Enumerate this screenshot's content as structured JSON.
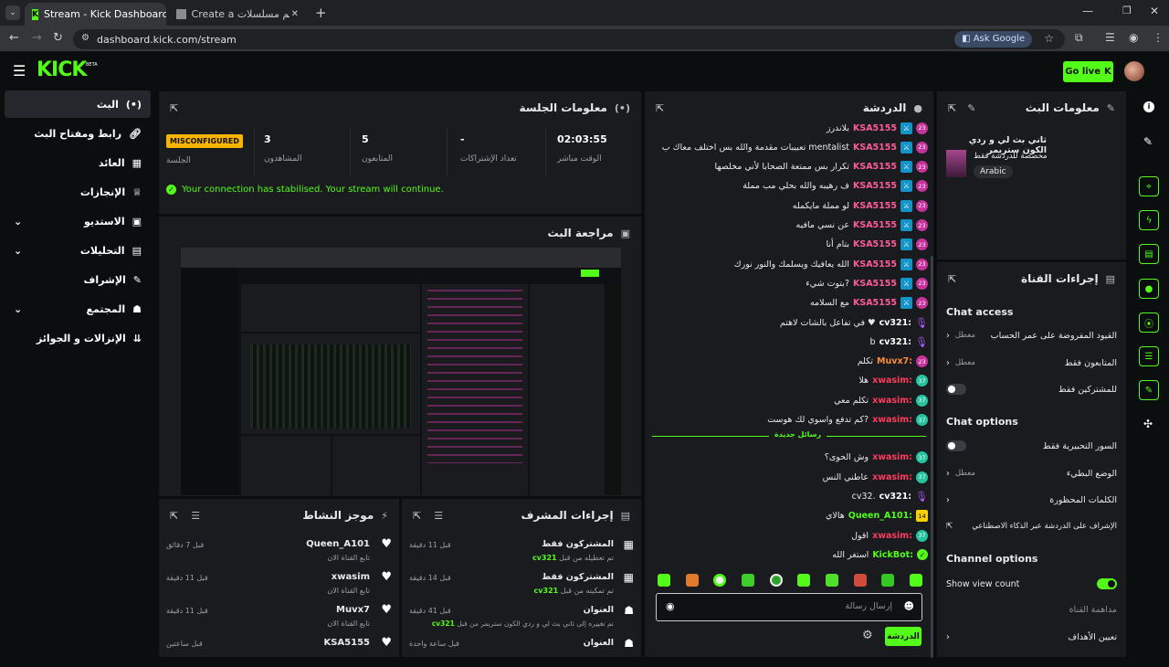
{
  "browser": {
    "tabs": [
      {
        "title": "Stream - Kick Dashboard"
      },
      {
        "title": "Create a تقييم مسلسلات Tier Li"
      }
    ],
    "url": "dashboard.kick.com/stream",
    "ask_google": "Ask Google"
  },
  "header": {
    "logo": "KICK",
    "beta": "BETA",
    "go_live": "Go live"
  },
  "nav": [
    {
      "label": "البث",
      "icon": "broadcast-icon"
    },
    {
      "label": "رابط ومفتاح البث",
      "icon": "link-icon"
    },
    {
      "label": "العائد",
      "icon": "analytics-icon"
    },
    {
      "label": "الإنجازات",
      "icon": "trophy-icon"
    },
    {
      "label": "الاستديو",
      "icon": "studio-icon"
    },
    {
      "label": "التحليلات",
      "icon": "chart-icon"
    },
    {
      "label": "الإشراف",
      "icon": "wrench-icon"
    },
    {
      "label": "المجتمع",
      "icon": "community-icon"
    },
    {
      "label": "الإنزالات و الجوائز",
      "icon": "drops-icon"
    }
  ],
  "session": {
    "title": "معلومات الجلسة",
    "stats": [
      {
        "value": "MISCONFIGURED",
        "label": "الجلسة"
      },
      {
        "value": "3",
        "label": "المشاهدون"
      },
      {
        "value": "5",
        "label": "المتابعون"
      },
      {
        "value": "-",
        "label": "تعداد الإشتراكات"
      },
      {
        "value": "02:03:55",
        "label": "الوقت مباشر"
      }
    ],
    "status": "Your connection has stabilised. Your stream will continue."
  },
  "preview": {
    "title": "مراجعة البث"
  },
  "chat": {
    "title": "الدردشة",
    "messages": [
      {
        "lvl": "23",
        "user": "KSA5155",
        "text": "بلاندرز",
        "type": "pink",
        "mod": true
      },
      {
        "lvl": "23",
        "user": "KSA5155",
        "text": "mentalist تعبيبات مقدمة والله بس اختلف معاك ب",
        "type": "pink",
        "mod": true
      },
      {
        "lvl": "23",
        "user": "KSA5155",
        "text": "تكرار بس ممتعة الصحابا لأني مخلصها",
        "type": "pink",
        "mod": true
      },
      {
        "lvl": "23",
        "user": "KSA5155",
        "text": "ف رهيبه والله بحلي مب مملة",
        "type": "pink",
        "mod": true
      },
      {
        "lvl": "23",
        "user": "KSA5155",
        "text": "لو مملة مايكمله",
        "type": "pink",
        "mod": true
      },
      {
        "lvl": "23",
        "user": "KSA5155",
        "text": "عن نسي مافيه",
        "type": "pink",
        "mod": true
      },
      {
        "lvl": "23",
        "user": "KSA5155",
        "text": "بتام أنا",
        "type": "pink",
        "mod": true
      },
      {
        "lvl": "23",
        "user": "KSA5155",
        "text": "الله يعافيك ويسلمك والنور نورك",
        "type": "pink",
        "mod": true
      },
      {
        "lvl": "23",
        "user": "KSA5155",
        "text": "?بتوت شيء",
        "type": "pink",
        "mod": true
      },
      {
        "lvl": "23",
        "user": "KSA5155",
        "text": "مع السلامه",
        "type": "pink",
        "mod": true
      },
      {
        "lvl": "",
        "user": "cv321:",
        "text": "♥ في تفاعل بالشات لاهتم",
        "type": "white",
        "mic": true
      },
      {
        "lvl": "",
        "user": "cv321:",
        "text": "b",
        "type": "white",
        "mic": true
      },
      {
        "lvl": "23",
        "user": "Muvx7:",
        "text": "تكلم",
        "type": "orange"
      },
      {
        "lvl": "37",
        "user": "xwasim:",
        "text": "هلا",
        "type": "red",
        "teal": true
      },
      {
        "lvl": "37",
        "user": "xwasim:",
        "text": "تكلم معي",
        "type": "red",
        "teal": true
      },
      {
        "lvl": "37",
        "user": "xwasim:",
        "text": "?كم تدفع واسوي لك هوست",
        "type": "red",
        "teal": true
      }
    ],
    "new_messages": "رسائل جديدة",
    "messages2": [
      {
        "lvl": "37",
        "user": "xwasim:",
        "text": "وش الحوى؟",
        "type": "red",
        "teal": true
      },
      {
        "lvl": "37",
        "user": "xwasim:",
        "text": "عاطني النس",
        "type": "red",
        "teal": true
      },
      {
        "lvl": "",
        "user": "cv321:",
        "text": ".cv32",
        "type": "white",
        "mic": true
      },
      {
        "lvl": "14",
        "user": "Queen_A101:",
        "text": "هالاي",
        "type": "green",
        "yellow": true
      },
      {
        "lvl": "37",
        "user": "xwasim:",
        "text": "اقول",
        "type": "red",
        "teal": true
      },
      {
        "lvl": "",
        "user": "KickBot:",
        "text": "استغر الله",
        "type": "green",
        "bot": true
      }
    ],
    "placeholder": "إرسال رسالة",
    "send": "الدردشة"
  },
  "stream_info": {
    "title": "معلومات البث",
    "stream_title": "ثاني بث لي و ردي الكون ستريمر",
    "category_note": "مخصصة للدردشة فقط",
    "tag": "Arabic"
  },
  "channel_actions": {
    "title": "إجراءات القناة",
    "chat_access": "Chat access",
    "rows_access": [
      {
        "label": "القيود المفروضة على عمر الحساب",
        "value": "معطل",
        "control": "chevron"
      },
      {
        "label": "المتابعون فقط",
        "value": "معطل",
        "control": "chevron"
      },
      {
        "label": "للمشتركين فقط",
        "value": "",
        "control": "toggle",
        "on": false
      }
    ],
    "chat_options": "Chat options",
    "rows_options": [
      {
        "label": "السور التحبيرية فقط",
        "value": "",
        "control": "toggle",
        "on": false
      },
      {
        "label": "الوضع البطيء",
        "value": "معطل",
        "control": "chevron"
      },
      {
        "label": "الكلمات المحظورة",
        "value": "",
        "control": "chevron"
      },
      {
        "label": "الإشراف على الدردشة عبر الذكاء الاصطناعي",
        "value": "",
        "control": "ext"
      }
    ],
    "channel_options": "Channel options",
    "rows_channel": [
      {
        "label": "Show view count",
        "value": "",
        "control": "toggle",
        "on": true
      },
      {
        "label": "مداهمة القناة",
        "value": "",
        "control": "none"
      },
      {
        "label": "تعيين الأهداف",
        "value": "",
        "control": "chevron"
      }
    ]
  },
  "activity": {
    "title": "موجز النشاط",
    "items": [
      {
        "user": "Queen_A101",
        "sub": "تابع القناة الان",
        "time": "قبل 7 دقائق"
      },
      {
        "user": "xwasim",
        "sub": "تابع القناة الان",
        "time": "قبل 11 دقيقة"
      },
      {
        "user": "Muvx7",
        "sub": "تابع القناة الان",
        "time": "قبل 11 دقيقة"
      },
      {
        "user": "KSA5155",
        "sub": "",
        "time": "قبل ساعتين"
      }
    ]
  },
  "mod_actions": {
    "title": "إجراءات المشرف",
    "items": [
      {
        "title": "المشتركون فقط",
        "sub": "تم تعطيله من قبل",
        "who": "cv321",
        "time": "قبل 11 دقيقة"
      },
      {
        "title": "المشتركون فقط",
        "sub": "تم تمكينه من قبل",
        "who": "cv321",
        "time": "قبل 14 دقيقة"
      },
      {
        "title": "العنوان",
        "sub": "تم تغييره إلى ثاني بث لي و ردي الكون ستريمر من قبل",
        "who": "cv321",
        "time": "قبل 41 دقيقة"
      },
      {
        "title": "العنوان",
        "sub": "",
        "who": "",
        "time": "قبل ساعة واحدة"
      }
    ]
  },
  "colors": {
    "accent": "#53fc18",
    "panel": "#191b1f",
    "bg": "#0b0e0f",
    "pink": "#ff5b9b",
    "red": "#ff3b5c",
    "green": "#53fc18",
    "orange": "#ff8c3a"
  }
}
